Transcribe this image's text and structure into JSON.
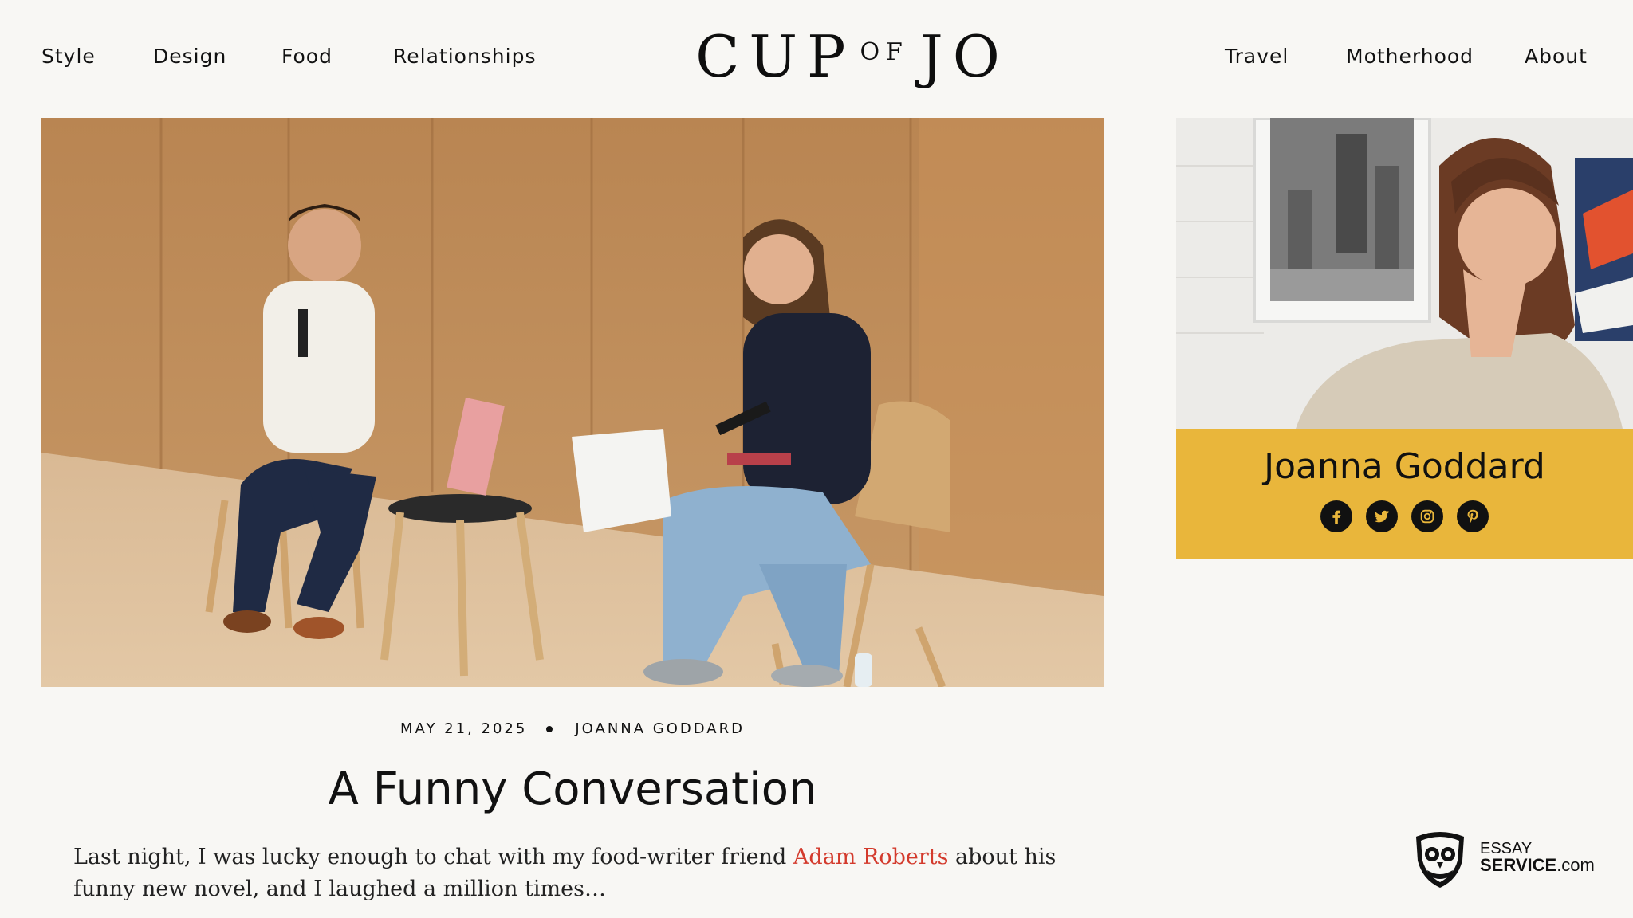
{
  "header": {
    "nav_left": [
      "Style",
      "Design",
      "Food",
      "Relationships"
    ],
    "logo": {
      "part1": "CUP",
      "part2": "OF",
      "part3": "JO"
    },
    "nav_right": [
      "Travel",
      "Motherhood",
      "About"
    ]
  },
  "sidebar": {
    "author_name": "Joanna Goddard",
    "social_icons": [
      "facebook-icon",
      "twitter-icon",
      "instagram-icon",
      "pinterest-icon"
    ],
    "card_color": "#e9b63b"
  },
  "article": {
    "date": "MAY 21, 2025",
    "author": "JOANNA GODDARD",
    "title": "A Funny Conversation",
    "excerpt_before": "Last night, I was lucky enough to chat with my food-writer friend ",
    "excerpt_link": "Adam Roberts",
    "excerpt_after": " about his funny new novel, and I laughed a million times…",
    "link_color": "#d33a2c"
  },
  "watermark": {
    "line1": "ESSAY",
    "line2_bold": "SERVICE",
    "line2_rest": ".com"
  }
}
